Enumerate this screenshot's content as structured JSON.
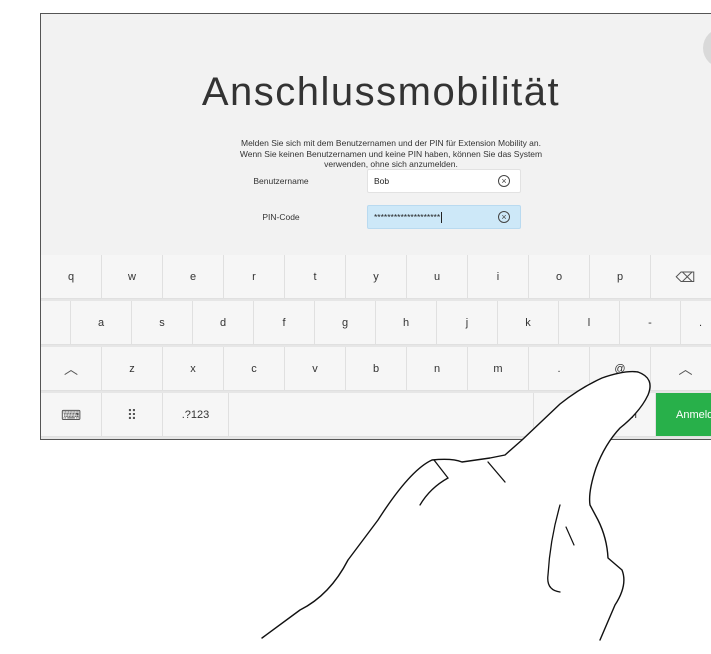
{
  "page": {
    "title": "Anschlussmobilität",
    "description_lines": [
      "Melden Sie sich mit dem Benutzernamen und der PIN für Extension Mobility an.",
      "Wenn Sie keinen Benutzernamen und keine PIN haben, können Sie das System",
      "verwenden, ohne sich anzumelden."
    ]
  },
  "form": {
    "username": {
      "label": "Benutzername",
      "value": "Bob",
      "clear_glyph": "×"
    },
    "pin": {
      "label": "PIN-Code",
      "value": "********************",
      "clear_glyph": "×"
    }
  },
  "keyboard": {
    "row1": [
      "q",
      "w",
      "e",
      "r",
      "t",
      "y",
      "u",
      "i",
      "o",
      "p",
      "⌫"
    ],
    "row2": [
      "a",
      "s",
      "d",
      "f",
      "g",
      "h",
      "j",
      "k",
      "l",
      "-",
      "."
    ],
    "row3": [
      "︿",
      "z",
      "x",
      "c",
      "v",
      "b",
      "n",
      "m",
      ".",
      "@",
      "︿"
    ],
    "row4": {
      "hide": "⌨",
      "symbols": "⠿",
      "numbers": ".?123",
      "space": "",
      "slash": "/",
      "dotcom": ".com",
      "submit": "Anmelden"
    }
  }
}
